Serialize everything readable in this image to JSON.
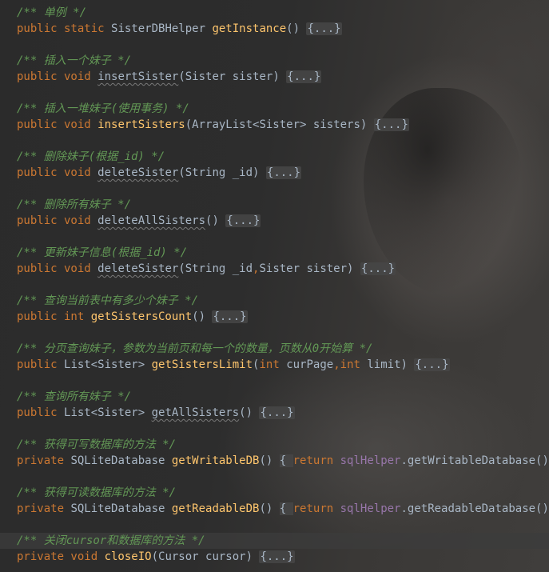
{
  "editor": {
    "lines": [
      {
        "kind": "comment",
        "text": "/** 单例 */"
      },
      {
        "kind": "code",
        "parts": [
          {
            "c": "kw",
            "t": "public static "
          },
          {
            "c": "id",
            "t": "SisterDBHelper "
          },
          {
            "c": "fn",
            "t": "getInstance"
          },
          {
            "c": "id",
            "t": "() "
          },
          {
            "c": "fold",
            "t": "{...}"
          }
        ]
      },
      {
        "kind": "comment",
        "text": "/** 插入一个妹子 */"
      },
      {
        "kind": "code",
        "parts": [
          {
            "c": "kw",
            "t": "public void "
          },
          {
            "c": "unused",
            "t": "insertSister"
          },
          {
            "c": "id",
            "t": "(Sister sister) "
          },
          {
            "c": "fold",
            "t": "{...}"
          }
        ]
      },
      {
        "kind": "comment",
        "text": "/** 插入一堆妹子(使用事务) */"
      },
      {
        "kind": "code",
        "parts": [
          {
            "c": "kw",
            "t": "public void "
          },
          {
            "c": "fn",
            "t": "insertSisters"
          },
          {
            "c": "id",
            "t": "(ArrayList<Sister> sisters) "
          },
          {
            "c": "fold",
            "t": "{...}"
          }
        ]
      },
      {
        "kind": "comment",
        "text": "/** 删除妹子(根据_id) */"
      },
      {
        "kind": "code",
        "parts": [
          {
            "c": "kw",
            "t": "public void "
          },
          {
            "c": "unused",
            "t": "deleteSister"
          },
          {
            "c": "id",
            "t": "(String _id) "
          },
          {
            "c": "fold",
            "t": "{...}"
          }
        ]
      },
      {
        "kind": "comment",
        "text": "/** 删除所有妹子 */"
      },
      {
        "kind": "code",
        "parts": [
          {
            "c": "kw",
            "t": "public void "
          },
          {
            "c": "unused",
            "t": "deleteAllSisters"
          },
          {
            "c": "id",
            "t": "() "
          },
          {
            "c": "fold",
            "t": "{...}"
          }
        ]
      },
      {
        "kind": "comment",
        "text": "/** 更新妹子信息(根据_id) */"
      },
      {
        "kind": "code",
        "parts": [
          {
            "c": "kw",
            "t": "public void "
          },
          {
            "c": "unused",
            "t": "deleteSister"
          },
          {
            "c": "id",
            "t": "(String _id"
          },
          {
            "c": "kw",
            "t": ","
          },
          {
            "c": "id",
            "t": "Sister sister) "
          },
          {
            "c": "fold",
            "t": "{...}"
          }
        ]
      },
      {
        "kind": "comment",
        "text": "/** 查询当前表中有多少个妹子 */"
      },
      {
        "kind": "code",
        "parts": [
          {
            "c": "kw",
            "t": "public int "
          },
          {
            "c": "fn",
            "t": "getSistersCount"
          },
          {
            "c": "id",
            "t": "() "
          },
          {
            "c": "fold",
            "t": "{...}"
          }
        ]
      },
      {
        "kind": "comment",
        "text": "/** 分页查询妹子，参数为当前页和每一个的数量，页数从0开始算 */"
      },
      {
        "kind": "code",
        "parts": [
          {
            "c": "kw",
            "t": "public "
          },
          {
            "c": "id",
            "t": "List<Sister> "
          },
          {
            "c": "fn",
            "t": "getSistersLimit"
          },
          {
            "c": "id",
            "t": "("
          },
          {
            "c": "kw",
            "t": "int "
          },
          {
            "c": "id",
            "t": "curPage"
          },
          {
            "c": "kw",
            "t": ","
          },
          {
            "c": "kw",
            "t": "int "
          },
          {
            "c": "id",
            "t": "limit) "
          },
          {
            "c": "fold",
            "t": "{...}"
          }
        ]
      },
      {
        "kind": "comment",
        "text": "/** 查询所有妹子 */"
      },
      {
        "kind": "code",
        "parts": [
          {
            "c": "kw",
            "t": "public "
          },
          {
            "c": "id",
            "t": "List<Sister> "
          },
          {
            "c": "unused",
            "t": "getAllSisters"
          },
          {
            "c": "id",
            "t": "() "
          },
          {
            "c": "fold",
            "t": "{...}"
          }
        ]
      },
      {
        "kind": "comment",
        "text": "/** 获得可写数据库的方法 */"
      },
      {
        "kind": "code",
        "parts": [
          {
            "c": "kw",
            "t": "private "
          },
          {
            "c": "id",
            "t": "SQLiteDatabase "
          },
          {
            "c": "fn",
            "t": "getWritableDB"
          },
          {
            "c": "id",
            "t": "() "
          },
          {
            "c": "brace",
            "t": "{ "
          },
          {
            "c": "kw",
            "t": "return "
          },
          {
            "c": "fld",
            "t": "sqlHelper"
          },
          {
            "c": "id",
            "t": ".getWritableDatabase()"
          },
          {
            "c": "kw",
            "t": "; "
          },
          {
            "c": "brace",
            "t": "}"
          }
        ]
      },
      {
        "kind": "comment",
        "text": "/** 获得可读数据库的方法 */"
      },
      {
        "kind": "code",
        "parts": [
          {
            "c": "kw",
            "t": "private "
          },
          {
            "c": "id",
            "t": "SQLiteDatabase "
          },
          {
            "c": "fn",
            "t": "getReadableDB"
          },
          {
            "c": "id",
            "t": "() "
          },
          {
            "c": "brace",
            "t": "{ "
          },
          {
            "c": "kw",
            "t": "return "
          },
          {
            "c": "fld",
            "t": "sqlHelper"
          },
          {
            "c": "id",
            "t": ".getReadableDatabase()"
          },
          {
            "c": "kw",
            "t": "; "
          },
          {
            "c": "brace",
            "t": "}"
          }
        ]
      },
      {
        "kind": "comment",
        "text": "/** 关闭cursor和数据库的方法 */",
        "current": true
      },
      {
        "kind": "code",
        "parts": [
          {
            "c": "kw",
            "t": "private void "
          },
          {
            "c": "fn",
            "t": "closeIO"
          },
          {
            "c": "id",
            "t": "(Cursor cursor) "
          },
          {
            "c": "fold",
            "t": "{...}"
          }
        ]
      }
    ]
  },
  "colors": {
    "background": "#2b2b2b",
    "keyword": "#cc7832",
    "identifier": "#a9b7c6",
    "method": "#ffc66d",
    "comment": "#629755",
    "field": "#9876aa"
  }
}
